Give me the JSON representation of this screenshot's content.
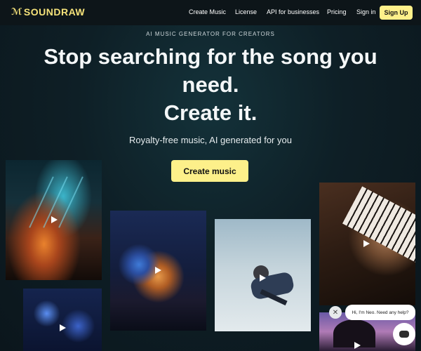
{
  "brand": {
    "name": "SOUNDRAW",
    "mark": "ℳ"
  },
  "nav": {
    "links": [
      "Create Music",
      "License",
      "API for businesses",
      "Pricing",
      "Sign in"
    ],
    "signup": "Sign Up"
  },
  "hero": {
    "eyebrow": "AI MUSIC GENERATOR FOR CREATORS",
    "headline_line1": "Stop searching for the song you need.",
    "headline_line2": "Create it.",
    "subtitle": "Royalty-free music, AI generated for you",
    "cta": "Create music"
  },
  "chat": {
    "close": "✕",
    "message": "Hi, I'm Neo. Need any help?"
  },
  "colors": {
    "accent": "#fdf08a",
    "logo": "#f5e27a",
    "background": "#0e1f26"
  }
}
